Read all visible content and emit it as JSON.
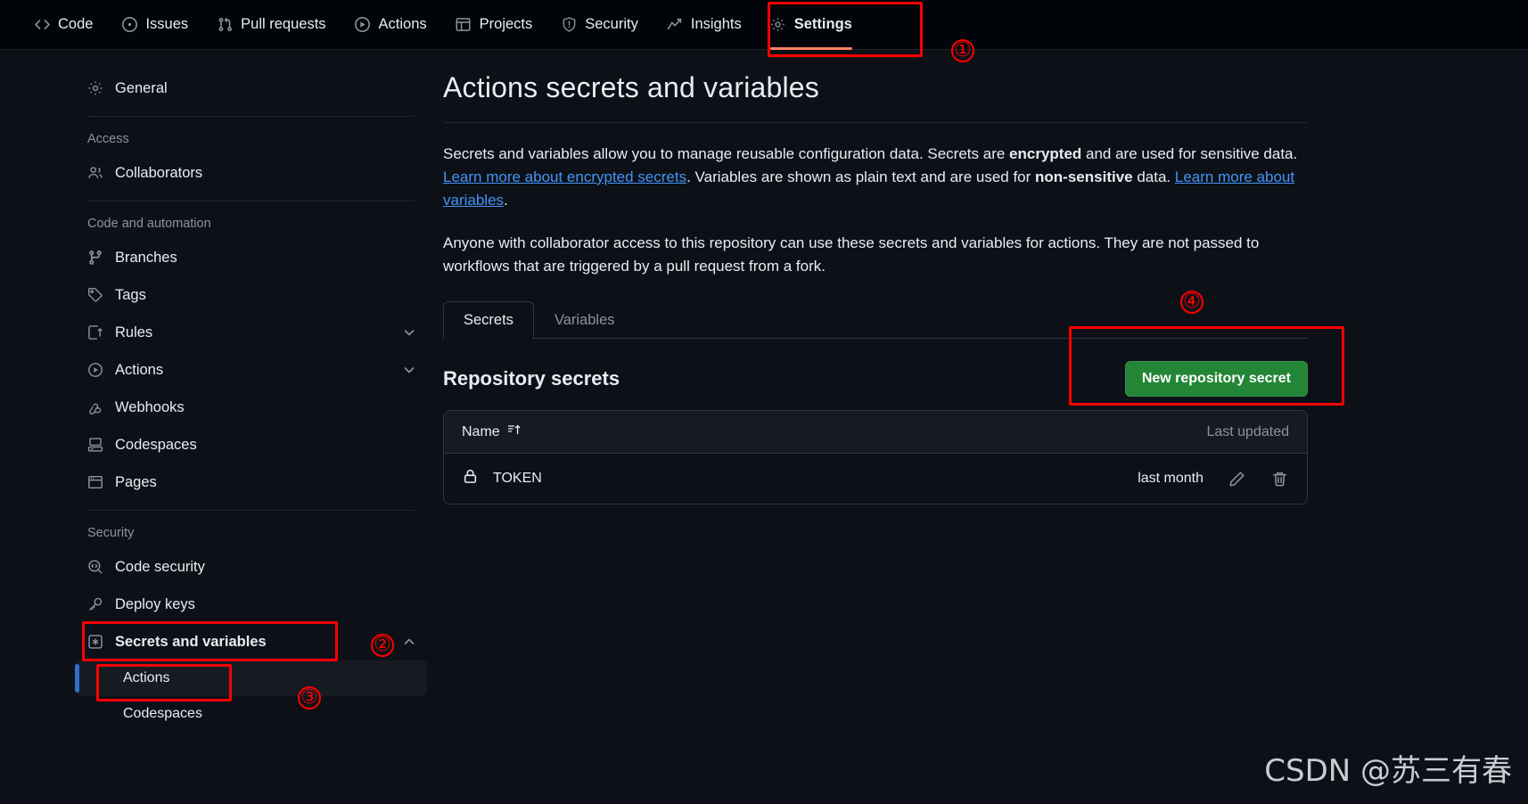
{
  "topnav": {
    "items": [
      {
        "label": "Code",
        "icon": "code-icon",
        "active": false
      },
      {
        "label": "Issues",
        "icon": "issue-opened-icon",
        "active": false
      },
      {
        "label": "Pull requests",
        "icon": "git-pull-request-icon",
        "active": false
      },
      {
        "label": "Actions",
        "icon": "play-icon",
        "active": false
      },
      {
        "label": "Projects",
        "icon": "table-icon",
        "active": false
      },
      {
        "label": "Security",
        "icon": "shield-icon",
        "active": false
      },
      {
        "label": "Insights",
        "icon": "graph-icon",
        "active": false
      },
      {
        "label": "Settings",
        "icon": "gear-icon",
        "active": true
      }
    ]
  },
  "sidebar": {
    "general": {
      "label": "General",
      "icon": "gear-icon"
    },
    "access_heading": "Access",
    "collaborators": {
      "label": "Collaborators",
      "icon": "people-icon"
    },
    "code_heading": "Code and automation",
    "code_items": [
      {
        "label": "Branches",
        "icon": "git-branch-icon",
        "chevron": ""
      },
      {
        "label": "Tags",
        "icon": "tag-icon",
        "chevron": ""
      },
      {
        "label": "Rules",
        "icon": "rules-icon",
        "chevron": "chevron-down-icon"
      },
      {
        "label": "Actions",
        "icon": "play-icon",
        "chevron": "chevron-down-icon"
      },
      {
        "label": "Webhooks",
        "icon": "webhook-icon",
        "chevron": ""
      },
      {
        "label": "Codespaces",
        "icon": "codespaces-icon",
        "chevron": ""
      },
      {
        "label": "Pages",
        "icon": "browser-icon",
        "chevron": ""
      }
    ],
    "security_heading": "Security",
    "security_items": [
      {
        "label": "Code security",
        "icon": "codescan-icon",
        "chevron": ""
      },
      {
        "label": "Deploy keys",
        "icon": "key-icon",
        "chevron": ""
      },
      {
        "label": "Secrets and variables",
        "icon": "asterisk-key-icon",
        "chevron": "chevron-up-icon",
        "bold": true
      }
    ],
    "secrets_subitems": [
      {
        "label": "Actions",
        "selected": true
      },
      {
        "label": "Codespaces",
        "selected": false
      }
    ]
  },
  "main": {
    "title": "Actions secrets and variables",
    "paragraph1": {
      "part1": "Secrets and variables allow you to manage reusable configuration data. Secrets are ",
      "bold1": "encrypted",
      "part2": " and are used for sensitive data. ",
      "link1": "Learn more about encrypted secrets",
      "part3": ". Variables are shown as plain text and are used for ",
      "bold2": "non-sensitive",
      "part4": " data. ",
      "link2": "Learn more about variables",
      "part5": "."
    },
    "paragraph2": "Anyone with collaborator access to this repository can use these secrets and variables for actions. They are not passed to workflows that are triggered by a pull request from a fork.",
    "tabs": [
      {
        "label": "Secrets",
        "active": true
      },
      {
        "label": "Variables",
        "active": false
      }
    ],
    "section_title": "Repository secrets",
    "new_secret_button": "New repository secret",
    "table": {
      "columns": [
        "Name",
        "Last updated"
      ],
      "sort_icon": "sort-asc-icon",
      "rows": [
        {
          "icon": "lock-icon",
          "name": "TOKEN",
          "last_updated": "last month",
          "edit_icon": "pencil-icon",
          "delete_icon": "trash-icon"
        }
      ]
    }
  },
  "annotations": {
    "markers": [
      "①",
      "②",
      "③",
      "④"
    ],
    "color": "#ff0000"
  },
  "watermark": "CSDN @苏三有春"
}
